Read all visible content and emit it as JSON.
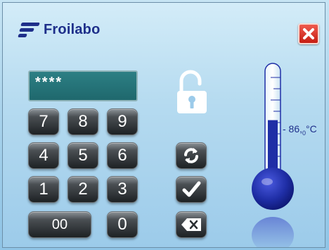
{
  "brand": {
    "name": "Froilabo",
    "color": "#1e2f8a"
  },
  "window": {
    "close_icon": "close-x-icon"
  },
  "display": {
    "value": "****"
  },
  "keypad": {
    "keys": [
      "7",
      "8",
      "9",
      "4",
      "5",
      "6",
      "1",
      "2",
      "3",
      "00",
      "0"
    ]
  },
  "lock": {
    "icon": "unlocked-padlock-icon",
    "state": "unlocked"
  },
  "actions": {
    "refresh_icon": "refresh-icon",
    "confirm_icon": "checkmark-icon",
    "backspace_icon": "backspace-icon"
  },
  "thermometer": {
    "reading": "- 86,",
    "reading_sub": "0",
    "reading_unit": "°C",
    "fill_level": 0.42,
    "accent": "#1f2ea6"
  }
}
